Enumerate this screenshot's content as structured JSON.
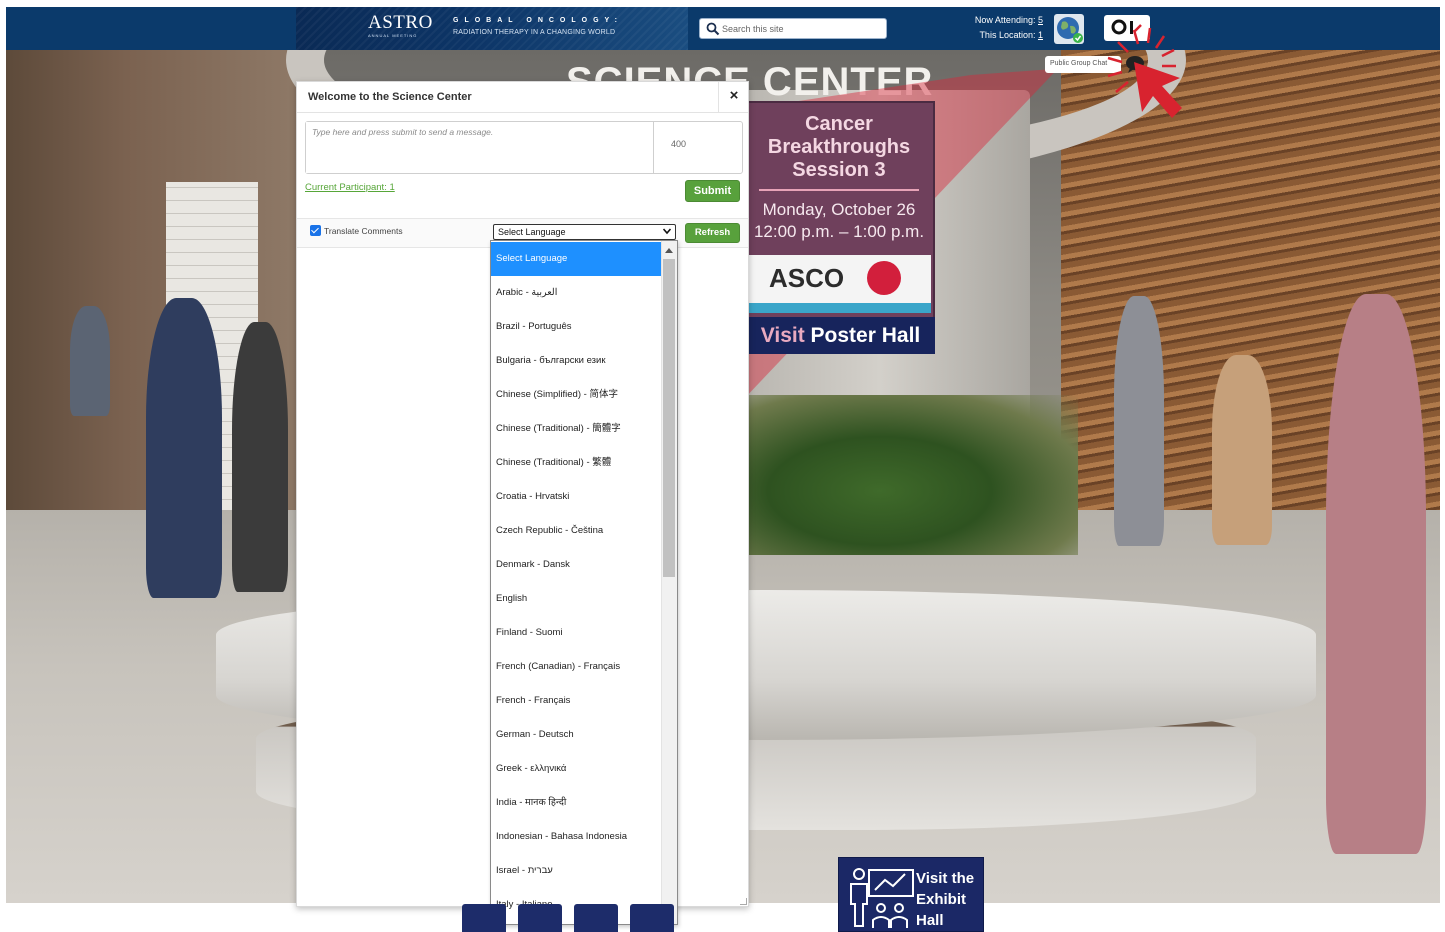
{
  "header": {
    "brand_name": "ASTRO",
    "brand_sub": "ANNUAL MEETING",
    "tagline_1": "GLOBAL ONCOLOGY:",
    "tagline_2": "RADIATION THERAPY IN A CHANGING WORLD",
    "search_placeholder": "Search this site",
    "now_attending_label": "Now Attending:",
    "now_attending_count": "5",
    "this_location_label": "This Location:",
    "this_location_count": "1",
    "public_group_chat_label": "Public Group Chat"
  },
  "scene": {
    "center_title": "SCIENCE CENTER",
    "billboard": {
      "title_lines": [
        "Cancer",
        "Breakthroughs",
        "Session 3"
      ],
      "date": "Monday, October 26",
      "time": "12:00 p.m. – 1:00 p.m.",
      "sponsor": "ASCO"
    },
    "poster_button_prefix": "Visit",
    "poster_button_rest": "Poster Hall",
    "exhibit_button_lines": [
      "Visit the",
      "Exhibit",
      "Hall"
    ]
  },
  "chat": {
    "title": "Welcome to the Science Center",
    "close_label": "×",
    "message_placeholder": "Type here and press submit to send a message.",
    "char_count": "400",
    "participants_label": "Current Participant: 1",
    "submit_label": "Submit",
    "translate_label": "Translate Comments",
    "translate_checked": true,
    "language_select_value": "Select Language",
    "refresh_label": "Refresh"
  },
  "language_options": [
    "Select Language",
    "Arabic - العربية",
    "Brazil - Português",
    "Bulgaria - български език",
    "Chinese (Simplified) - 简体字",
    "Chinese (Traditional) - 簡體字",
    "Chinese (Traditional) - 繁體",
    "Croatia - Hrvatski",
    "Czech Republic - Čeština",
    "Denmark - Dansk",
    "English",
    "Finland - Suomi",
    "French (Canadian) - Français",
    "French - Français",
    "German - Deutsch",
    "Greek - ελληνικά",
    "India - मानक हिन्दी",
    "Indonesian - Bahasa Indonesia",
    "Israel - עברית",
    "Italy - Italiano"
  ],
  "colors": {
    "header_blue": "#0b3a6b",
    "accent_green": "#58a13c",
    "selected_blue": "#1e90ff",
    "billboard_purple": "#6f405c",
    "poster_navy": "#17245c",
    "highlight_red": "#d8232f"
  }
}
